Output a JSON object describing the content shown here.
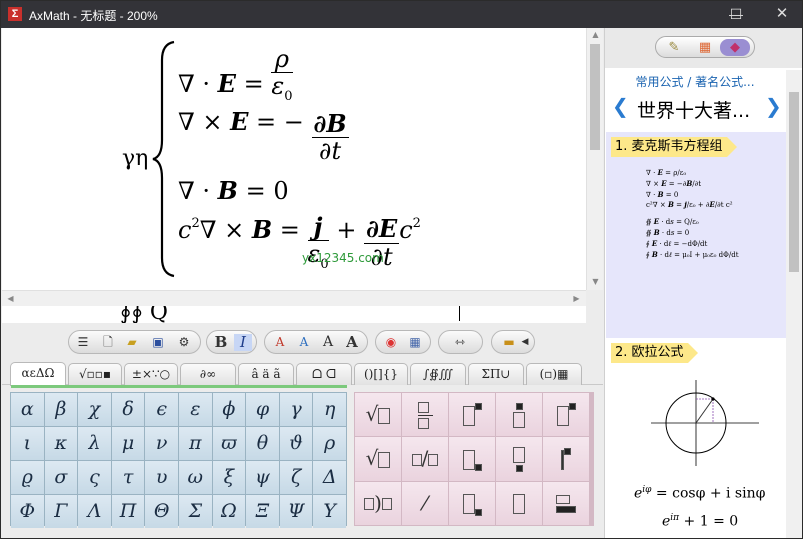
{
  "window": {
    "title": "AxMath - 无标题 - 200%",
    "icon_glyph": "Σ",
    "min_glyph": "—",
    "max_glyph": "☐",
    "close_glyph": "✕"
  },
  "editor": {
    "lhs": "γη",
    "line1": {
      "a": "∇ · ",
      "E": "E",
      "eq": " = ",
      "num": "ρ",
      "den": "ε",
      "sub": "0"
    },
    "line2": {
      "a": "∇ × ",
      "E": "E",
      "eq": " = − ",
      "num": "∂B",
      "den": "∂t"
    },
    "line3": {
      "a": "∇ · ",
      "B": "B",
      "eq": " = 0"
    },
    "line4": {
      "c2": "c",
      "sup": "2",
      "a": "∇ × ",
      "B": "B",
      "eq": " = ",
      "num1": "j",
      "den1": "ε",
      "sub1": "0",
      "plus": " + ",
      "num2": "∂E",
      "den2": "∂t",
      "c": "c",
      "sup2": "2"
    },
    "watermark": "yx12345.com",
    "cutoff_text": "∮∮                 Q"
  },
  "toolbar": {
    "bold": "B",
    "italic": "I",
    "font_a1": "A",
    "font_a2": "A",
    "font_a3": "A",
    "font_a4": "A"
  },
  "tabs": [
    "αεΔΩ",
    "√▫▫▪",
    "±×∵○",
    "∂∞",
    "â ä ã",
    "ᗝ ᗡ",
    "()[]{}",
    "∫∯∭",
    "ΣΠ∪",
    "(▫)▦"
  ],
  "greek": [
    [
      "α",
      "β",
      "χ",
      "δ",
      "ϵ",
      "ε",
      "ϕ",
      "φ",
      "γ",
      "η"
    ],
    [
      "ι",
      "κ",
      "λ",
      "μ",
      "ν",
      "π",
      "ϖ",
      "θ",
      "ϑ",
      "ρ"
    ],
    [
      "ϱ",
      "σ",
      "ς",
      "τ",
      "υ",
      "ω",
      "ξ",
      "ψ",
      "ζ",
      "Δ"
    ],
    [
      "Φ",
      "Γ",
      "Λ",
      "Π",
      "Θ",
      "Σ",
      "Ω",
      "Ξ",
      "Ψ",
      "Υ"
    ]
  ],
  "right_panel": {
    "breadcrumb": "常用公式 / 著名公式...",
    "title": "世界十大著...",
    "prev_glyph": "❮",
    "next_glyph": "❯",
    "sections": [
      {
        "label": "1. 麦克斯韦方程组"
      },
      {
        "label": "2. 欧拉公式"
      }
    ],
    "euler1": "e^{iφ} = cosφ + i sinφ",
    "euler1_text": "e",
    "euler1_sup": "iφ",
    "euler1_rest": " = cosφ + i sinφ",
    "euler2_text": "e",
    "euler2_sup": "iπ",
    "euler2_rest": " + 1 = 0"
  },
  "colors": {
    "titlebar": "#333338",
    "section_bg": "#e6e6fb",
    "label_bg": "#fde88a",
    "greek_bg": "#c6d9e6",
    "template_bg": "#ead3de"
  }
}
